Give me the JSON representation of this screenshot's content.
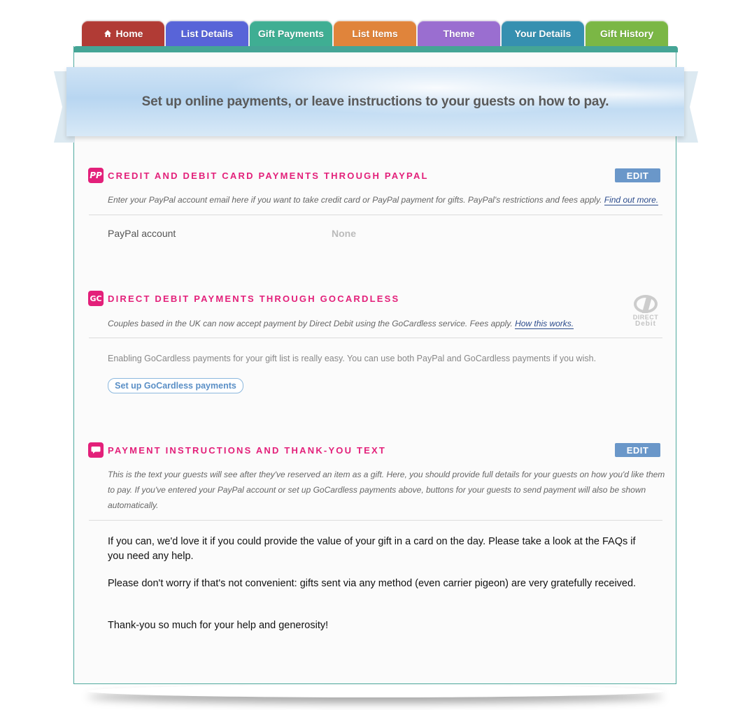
{
  "tabs": [
    {
      "label": "Home",
      "color": "#b13b35",
      "icon": "home-icon"
    },
    {
      "label": "List Details",
      "color": "#5864d8"
    },
    {
      "label": "Gift Payments",
      "color": "#3fae93"
    },
    {
      "label": "List Items",
      "color": "#e0843b"
    },
    {
      "label": "Theme",
      "color": "#9a6ed0"
    },
    {
      "label": "Your Details",
      "color": "#3690b0"
    },
    {
      "label": "Gift History",
      "color": "#7bb745"
    }
  ],
  "banner": {
    "title": "Set up online payments, or leave instructions to your guests on how to pay."
  },
  "paypal": {
    "icon_text": "PP",
    "title": "Credit and debit card payments through PayPal",
    "edit_label": "EDIT",
    "description": "Enter your PayPal account email here if you want to take credit card or PayPal payment for gifts. PayPal's restrictions and fees apply.",
    "link": "Find out more.",
    "account_label": "PayPal account",
    "account_value": "None"
  },
  "gocardless": {
    "icon_text": "GC",
    "title": "Direct debit payments through GoCardless",
    "description": "Couples based in the UK can now accept payment by Direct Debit using the GoCardless service. Fees apply.",
    "link": "How this works.",
    "info": "Enabling GoCardless payments for your gift list is really easy. You can use both PayPal and GoCardless payments if you wish.",
    "button": "Set up GoCardless payments",
    "logo_line1": "DIRECT",
    "logo_line2": "Debit"
  },
  "instructions": {
    "title": "Payment instructions and thank-you text",
    "edit_label": "EDIT",
    "description_1": "This is the text your guests will see after they've reserved an item as a gift. Here, you should provide full details for your guests on how you'd like them",
    "description_2": "to pay. If you've entered your PayPal account or set up GoCardless payments above, buttons for your guests to send payment will also be shown",
    "description_3": "automatically.",
    "para1": "If you can, we'd love it if you could provide the value of your gift in a card on the day. Please take a look at the FAQs if you need any help.",
    "para2": "Please don't worry if that's not convenient: gifts sent via any method (even carrier pigeon) are very gratefully received.",
    "para3": "Thank-you so much for your help and generosity!"
  }
}
